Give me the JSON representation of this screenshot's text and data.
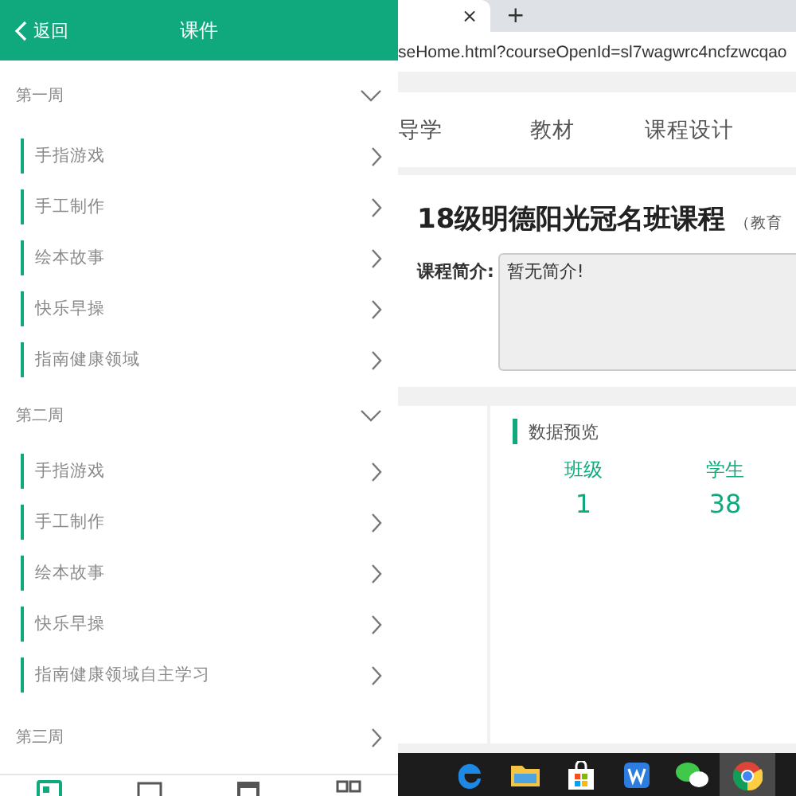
{
  "mobile": {
    "header": {
      "back_label": "返回",
      "title": "课件"
    },
    "weeks": [
      {
        "title": "第一周",
        "expanded": true,
        "items": [
          "手指游戏",
          "手工制作",
          "绘本故事",
          "快乐早操",
          "指南健康领域"
        ]
      },
      {
        "title": "第二周",
        "expanded": true,
        "items": [
          "手指游戏",
          "手工制作",
          "绘本故事",
          "快乐早操",
          "指南健康领域自主学习"
        ]
      },
      {
        "title": "第三周",
        "expanded": false
      }
    ],
    "bottom_tabs": [
      {
        "selected": true
      },
      {
        "selected": false
      },
      {
        "selected": false
      },
      {
        "selected": false
      }
    ]
  },
  "browser": {
    "tab_close": "×",
    "new_tab": "+",
    "url": "seHome.html?courseOpenId=sl7wagwrc4ncfzwcqao",
    "nav": [
      "导学",
      "教材",
      "课程设计"
    ],
    "course_title": "18级明德阳光冠名班课程",
    "course_subtitle": "（教育",
    "intro_label": "课程简介:",
    "intro_value": "暂无简介!",
    "overview": {
      "title": "数据预览",
      "stats": [
        {
          "label": "班级",
          "value": "1"
        },
        {
          "label": "学生",
          "value": "38"
        }
      ]
    }
  },
  "taskbar": {
    "apps": [
      {
        "kind": "edge",
        "selected": false
      },
      {
        "kind": "folder",
        "selected": false
      },
      {
        "kind": "store",
        "selected": false
      },
      {
        "kind": "wps",
        "selected": false
      },
      {
        "kind": "wechat",
        "selected": false
      },
      {
        "kind": "chrome",
        "selected": true
      }
    ]
  }
}
